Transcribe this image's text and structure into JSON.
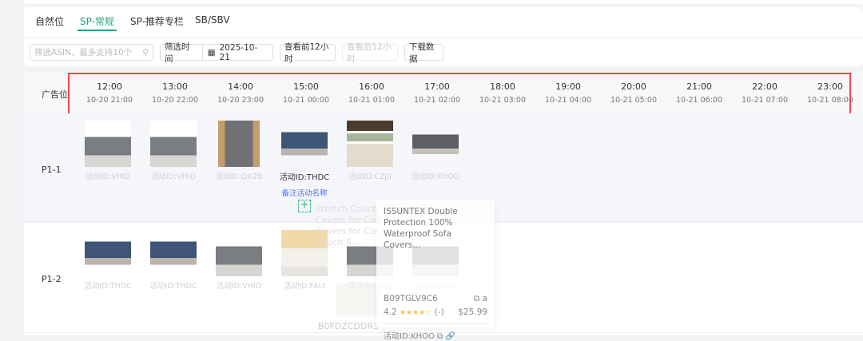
{
  "tabs": [
    "自然位",
    "SP-常规",
    "SP-推荐专栏",
    "SB/SBV"
  ],
  "active_tab": "SP-常规",
  "filters": {
    "search_placeholder": "筛选ASIN，最多支持10个",
    "time_label": "筛选时间",
    "date": "2025-10-21",
    "prev_btn": "查看前12小时",
    "next_btn": "查看后12小时",
    "download_btn": "下载数据"
  },
  "table": {
    "placement_header": "广告位",
    "columns": [
      {
        "time": "12:00",
        "date": "10-20 21:00"
      },
      {
        "time": "13:00",
        "date": "10-20 22:00"
      },
      {
        "time": "14:00",
        "date": "10-20 23:00"
      },
      {
        "time": "15:00",
        "date": "10-21 00:00"
      },
      {
        "time": "16:00",
        "date": "10-21 01:00"
      },
      {
        "time": "17:00",
        "date": "10-21 02:00"
      },
      {
        "time": "18:00",
        "date": "10-21 03:00"
      },
      {
        "time": "19:00",
        "date": "10-21 04:00"
      },
      {
        "time": "20:00",
        "date": "10-21 05:00"
      },
      {
        "time": "21:00",
        "date": "10-21 06:00"
      },
      {
        "time": "22:00",
        "date": "10-21 07:00"
      },
      {
        "time": "23:00",
        "date": "10-21 08:00"
      }
    ],
    "rows": [
      {
        "label": "P1-1",
        "cells": [
          {
            "id": "活动ID:VHIO",
            "img": "sofa-gray"
          },
          {
            "id": "活动ID:VHIO",
            "img": "sofa-gray"
          },
          {
            "id": "活动ID:QX2B",
            "img": "chair"
          },
          {
            "id": "活动ID:THDC",
            "img": "sofa-blue",
            "note": "备注活动名称"
          },
          {
            "id": "活动ID:C2J0",
            "img": "multi"
          },
          {
            "id": "活动ID:KHOO",
            "img": "sofa-dark"
          }
        ]
      },
      {
        "label": "P1-2",
        "cells": [
          {
            "id": "活动ID:THDC",
            "img": "sofa-blue"
          },
          {
            "id": "活动ID:THDC",
            "img": "sofa-blue"
          },
          {
            "id": "活动ID:VHIO",
            "img": "sofa-gray"
          },
          {
            "id": "活动ID:FALI",
            "img": "room"
          },
          {
            "id": "活动ID:CJ2Q",
            "img": "sofa-gray"
          },
          {
            "id": "活动ID:CJ2Q",
            "img": "sofa-gray"
          }
        ]
      }
    ]
  },
  "ghost_tooltip": {
    "title": "Stretch Couch Covers for Couch Covers for Cushion Couch S...",
    "asin": "B0FDZCDDR3"
  },
  "tooltip": {
    "title": "ISSUNTEX Double Protection 100% Waterproof Sofa Covers...",
    "asin": "B09TGLV9C6",
    "rating": "4.2",
    "stars": 4,
    "reviews": "(-)",
    "price": "$25.99",
    "campaign": "活动ID:KHOO"
  },
  "colors": {
    "accent": "#1fa77a",
    "highlight": "#f0484e",
    "link": "#4f6cf5"
  }
}
